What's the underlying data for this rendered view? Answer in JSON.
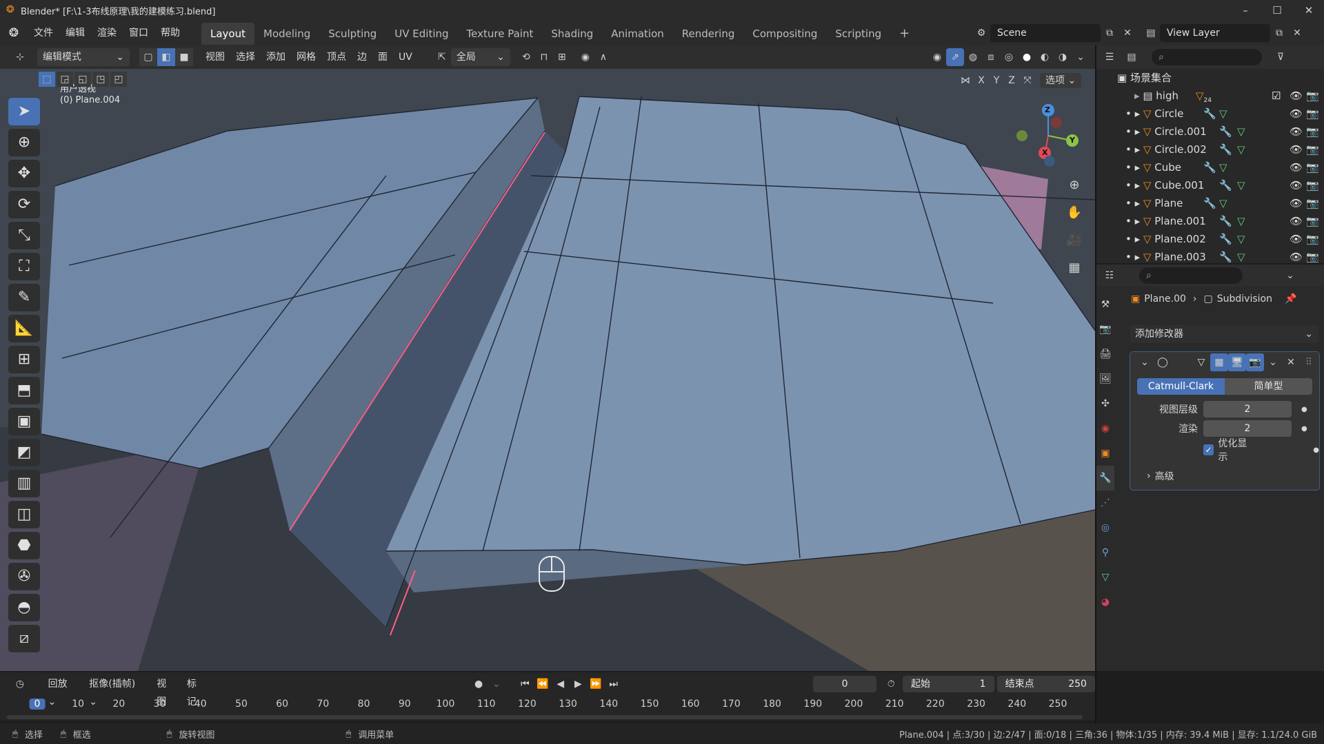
{
  "window": {
    "title": "Blender* [F:\\1-3布线原理\\我的建模练习.blend]",
    "min": "–",
    "max": "☐",
    "close": "✕"
  },
  "menu": {
    "items": [
      "文件",
      "编辑",
      "渲染",
      "窗口",
      "帮助"
    ]
  },
  "workspaces": [
    "Layout",
    "Modeling",
    "Sculpting",
    "UV Editing",
    "Texture Paint",
    "Shading",
    "Animation",
    "Rendering",
    "Compositing",
    "Scripting",
    "+"
  ],
  "scene": {
    "name": "Scene",
    "view_layer": "View Layer"
  },
  "header": {
    "mode": "编辑模式",
    "menus": [
      "视图",
      "选择",
      "添加",
      "网格",
      "顶点",
      "边",
      "面",
      "UV"
    ],
    "transform_orientation": "全局",
    "axes": [
      "X",
      "Y",
      "Z"
    ],
    "options": "选项"
  },
  "viewport": {
    "perspective": "用户透视",
    "object": "(0) Plane.004"
  },
  "gizmo": {
    "x": "X",
    "y": "Y",
    "z": "Z"
  },
  "outliner": {
    "collection": "场景集合",
    "items": [
      {
        "name": "high",
        "badge": "24"
      },
      {
        "name": "Circle"
      },
      {
        "name": "Circle.001"
      },
      {
        "name": "Circle.002"
      },
      {
        "name": "Cube"
      },
      {
        "name": "Cube.001"
      },
      {
        "name": "Plane"
      },
      {
        "name": "Plane.001"
      },
      {
        "name": "Plane.002"
      },
      {
        "name": "Plane.003"
      }
    ]
  },
  "properties": {
    "breadcrumb_object": "Plane.00",
    "breadcrumb_modifier": "Subdivision",
    "add_modifier": "添加修改器",
    "tab_catmull": "Catmull-Clark",
    "tab_simple": "简单型",
    "viewport_levels_label": "视图层级",
    "viewport_levels": "2",
    "render_label": "渲染",
    "render_levels": "2",
    "optimal_display": "优化显示",
    "advanced": "高级"
  },
  "timeline": {
    "menus": [
      "回放",
      "抠像(插帧)",
      "视图",
      "标记"
    ],
    "current_frame": "0",
    "start_label": "起始",
    "start": "1",
    "end_label": "结束点",
    "end": "250",
    "ruler": [
      "0",
      "10",
      "20",
      "30",
      "40",
      "50",
      "60",
      "70",
      "80",
      "90",
      "100",
      "110",
      "120",
      "130",
      "140",
      "150",
      "160",
      "170",
      "180",
      "190",
      "200",
      "210",
      "220",
      "230",
      "240",
      "250"
    ]
  },
  "status": {
    "select": "选择",
    "box_select": "框选",
    "rotate_view": "旋转视图",
    "call_menu": "调用菜单",
    "stats": "Plane.004 | 点:3/30 | 边:2/47 | 面:0/18 | 三角:36 | 物体:1/35 | 内存: 39.4 MiB | 显存: 1.1/24.0 GiB"
  }
}
